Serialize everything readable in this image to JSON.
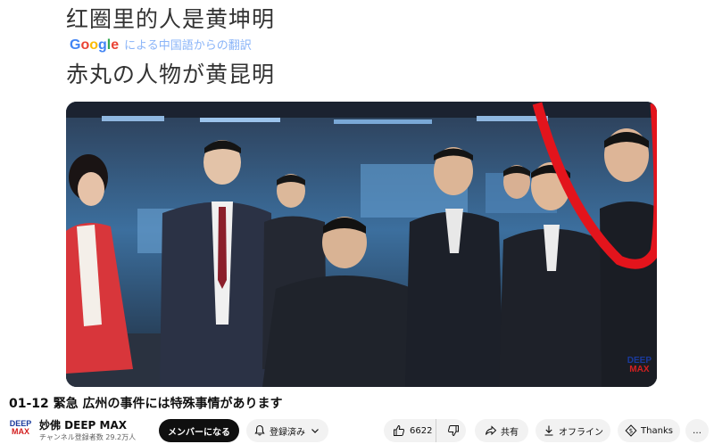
{
  "caption": {
    "chinese": "红圈里的人是黄坤明",
    "google_logo": [
      "G",
      "o",
      "o",
      "g",
      "l",
      "e"
    ],
    "translation_note": "による中国語からの翻訳",
    "japanese": "赤丸の人物が黄昆明"
  },
  "video": {
    "watermark_line1": "DEEP",
    "watermark_line2": "MAX"
  },
  "title": "01-12 緊急 広州の事件には特殊事情があります",
  "channel": {
    "avatar_line1": "DEEP",
    "avatar_line2": "MAX",
    "name": "妙佛 DEEP MAX",
    "subscribers": "チャンネル登録者数 29.2万人"
  },
  "actions": {
    "member_label": "メンバーになる",
    "subscribed_label": "登録済み",
    "like_count": "6622",
    "share_label": "共有",
    "offline_label": "オフライン",
    "thanks_label": "Thanks",
    "more_label": "…"
  },
  "colors": {
    "circle_annotation": "#e3141c",
    "member_button": "#0f0f0f",
    "pill_background": "#f2f2f2"
  }
}
